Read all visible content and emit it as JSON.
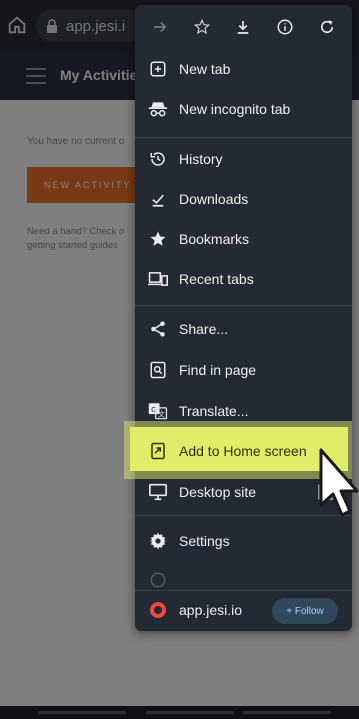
{
  "browser": {
    "url": "app.jesi.i"
  },
  "app": {
    "title": "My Activities",
    "no_activity_text": "You have no current o",
    "new_activity_label": "NEW ACTIVITY",
    "help_text": "Need a hand? Check o getting started guides"
  },
  "menu": {
    "toolbar_icons": [
      "forward-icon",
      "bookmark-star-icon",
      "download-icon",
      "info-icon",
      "refresh-icon"
    ],
    "items": [
      {
        "label": "New tab",
        "icon": "new-tab-icon"
      },
      {
        "label": "New incognito tab",
        "icon": "incognito-icon"
      },
      {
        "label": "History",
        "icon": "history-icon"
      },
      {
        "label": "Downloads",
        "icon": "downloads-icon"
      },
      {
        "label": "Bookmarks",
        "icon": "bookmarks-star-icon"
      },
      {
        "label": "Recent tabs",
        "icon": "recent-tabs-icon"
      },
      {
        "label": "Share...",
        "icon": "share-icon"
      },
      {
        "label": "Find in page",
        "icon": "find-in-page-icon"
      },
      {
        "label": "Translate...",
        "icon": "translate-icon"
      },
      {
        "label": "Add to Home screen",
        "icon": "add-to-home-icon"
      },
      {
        "label": "Desktop site",
        "icon": "desktop-icon"
      },
      {
        "label": "Settings",
        "icon": "settings-gear-icon"
      }
    ],
    "desktop_site_checked": false,
    "site_chip": {
      "label": "app.jesi.io",
      "follow_label": "+ Follow"
    }
  },
  "colors": {
    "menu_bg": "#242a33",
    "highlight": "#e3ec68",
    "accent_orange": "#f2732e",
    "follow_text": "#a8d1ff"
  }
}
